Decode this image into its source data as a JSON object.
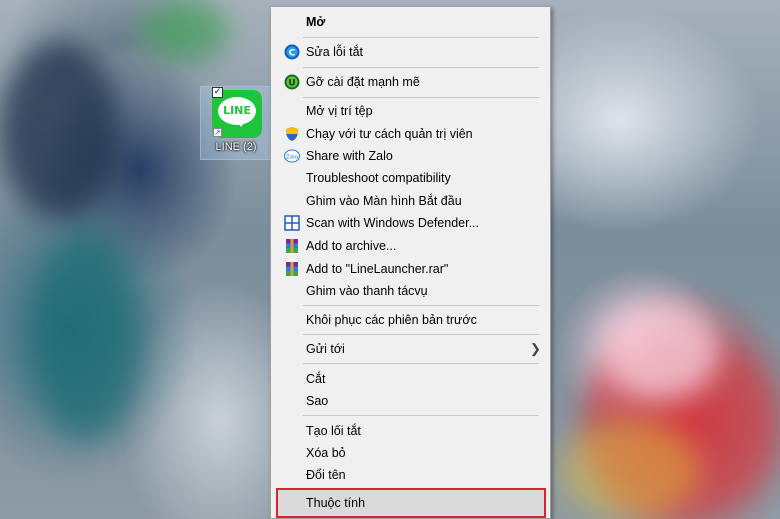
{
  "desktop": {
    "shortcut": {
      "label": "LINE (2)",
      "logo_text": "LINE"
    }
  },
  "menu": {
    "items": [
      {
        "label": "Mở",
        "icon": ""
      },
      {
        "label": "Sửa lỗi tắt",
        "icon": "repair-icon"
      },
      {
        "label": "Gỡ cài đặt mạnh mẽ",
        "icon": "uninstall-icon"
      },
      {
        "label": "Mở vị trí tệp",
        "icon": ""
      },
      {
        "label": "Chạy với tư cách quản trị viên",
        "icon": "shield-icon"
      },
      {
        "label": "Share with Zalo",
        "icon": "zalo-icon"
      },
      {
        "label": "Troubleshoot compatibility",
        "icon": ""
      },
      {
        "label": "Ghim vào Màn hình Bắt đầu",
        "icon": ""
      },
      {
        "label": "Scan with Windows Defender...",
        "icon": "defender-icon"
      },
      {
        "label": "Add to archive...",
        "icon": "winrar-icon"
      },
      {
        "label": "Add to \"LineLauncher.rar\"",
        "icon": "winrar-icon"
      },
      {
        "label": "Ghim vào thanh tácvụ",
        "icon": ""
      },
      {
        "label": "Khôi phục các phiên bản trước",
        "icon": ""
      },
      {
        "label": "Gửi tới",
        "icon": ""
      },
      {
        "label": "Cắt",
        "icon": ""
      },
      {
        "label": "Sao",
        "icon": ""
      },
      {
        "label": "Tạo lối tắt",
        "icon": ""
      },
      {
        "label": "Xóa bỏ",
        "icon": ""
      },
      {
        "label": "Đổi tên",
        "icon": ""
      },
      {
        "label": "Thuộc tính",
        "icon": ""
      }
    ],
    "colors": {
      "menu_bg": "#f0f0f0",
      "highlight_border": "#d9232d",
      "line_green": "#1fc43a"
    }
  }
}
